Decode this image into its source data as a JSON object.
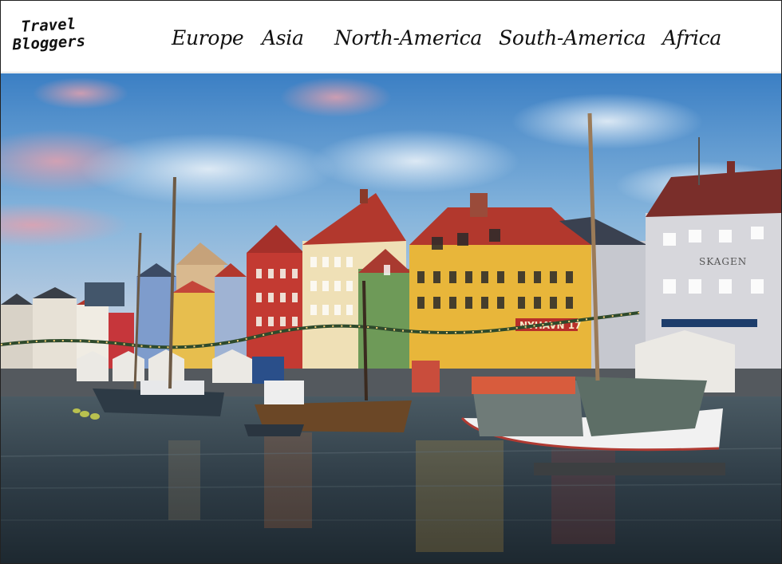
{
  "brand": {
    "line1": "Travel",
    "line2": "Bloggers"
  },
  "nav": {
    "items": [
      {
        "label": "Europe"
      },
      {
        "label": "Asia"
      },
      {
        "label": "North-America"
      },
      {
        "label": "South-America"
      },
      {
        "label": "Africa"
      }
    ]
  },
  "hero": {
    "shop_sign": "NYHAVN 17",
    "building_sign": "SKAGEN",
    "colors": {
      "sky_top": "#3f86c9",
      "sky_mid": "#7fb2da",
      "sky_pink": "#d89aa6",
      "water_top": "#3d4d57",
      "water_bottom": "#1f2a33",
      "yellow_house": "#e8b63a",
      "red_house": "#c33a32",
      "roof_red": "#b2382d"
    }
  }
}
